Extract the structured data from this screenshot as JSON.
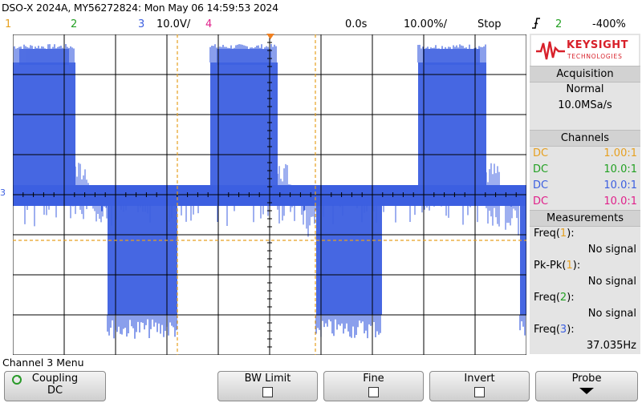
{
  "header": {
    "title": "DSO-X 2024A, MY56272824: Mon May 06 14:59:53 2024",
    "ch1": "1",
    "ch2": "2",
    "ch3": "3",
    "ch3_scale": "10.0V/",
    "ch4": "4",
    "time_delay": "0.0s",
    "time_scale": "10.00%/",
    "run_state": "Stop",
    "trigger_slope_icon": "rising-edge-icon",
    "trigger_source": "2",
    "trigger_level": "-400%"
  },
  "colors": {
    "ch1": "#e6a020",
    "ch2": "#22a022",
    "ch3": "#3c5fe0",
    "ch4": "#e0208a",
    "grid": "#000000"
  },
  "panel": {
    "logo_name": "KEYSIGHT",
    "logo_sub": "TECHNOLOGIES",
    "acquisition_header": "Acquisition",
    "acq_mode": "Normal",
    "acq_rate": "10.0MSa/s",
    "channels_header": "Channels",
    "channels": [
      {
        "coupling": "DC",
        "probe": "1.00:1",
        "color": "#e6a020"
      },
      {
        "coupling": "DC",
        "probe": "10.0:1",
        "color": "#22a022"
      },
      {
        "coupling": "DC",
        "probe": "10.0:1",
        "color": "#3c5fe0"
      },
      {
        "coupling": "DC",
        "probe": "10.0:1",
        "color": "#e0208a"
      }
    ],
    "measurements_header": "Measurements",
    "measurements": [
      {
        "name": "Freq(",
        "ch": "1",
        "close": "):",
        "value": "No signal",
        "color": "#e6a020"
      },
      {
        "name": "Pk-Pk(",
        "ch": "1",
        "close": "):",
        "value": "No signal",
        "color": "#e6a020"
      },
      {
        "name": "Freq(",
        "ch": "2",
        "close": "):",
        "value": "No signal",
        "color": "#22a022"
      },
      {
        "name": "Freq(",
        "ch": "3",
        "close": "):",
        "value": "37.035Hz",
        "color": "#3c5fe0"
      }
    ]
  },
  "menu": {
    "title": "Channel 3 Menu",
    "coupling_label": "Coupling",
    "coupling_value": "DC",
    "bw_limit": "BW Limit",
    "fine": "Fine",
    "invert": "Invert",
    "probe": "Probe"
  },
  "screen": {
    "ch3_marker": "3"
  }
}
